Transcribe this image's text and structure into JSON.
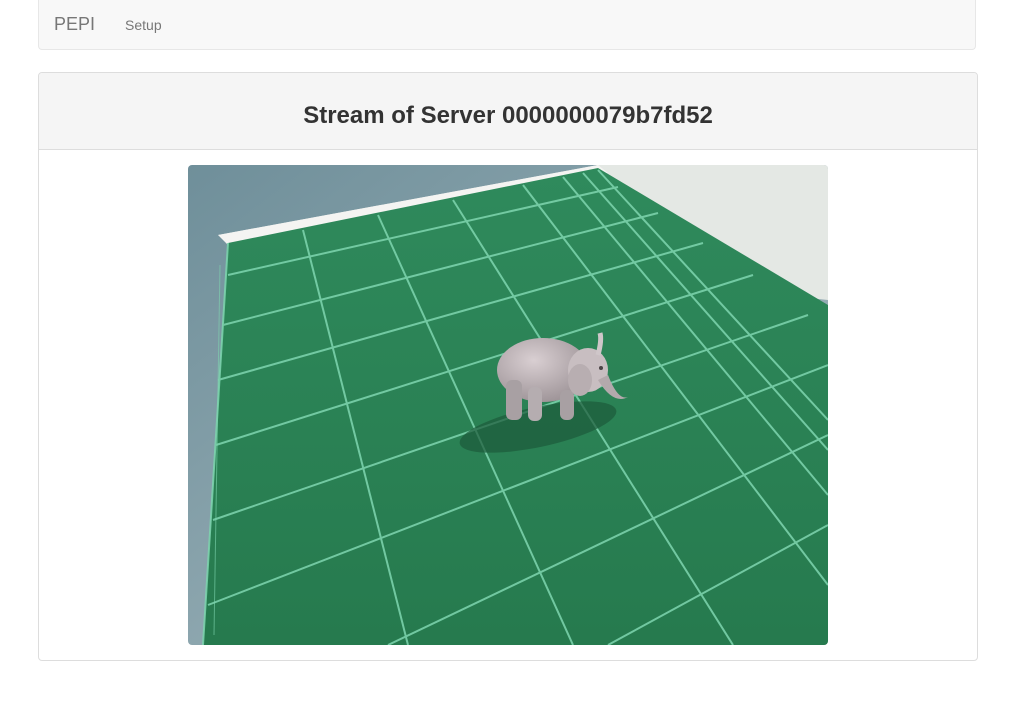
{
  "navbar": {
    "brand": "PEPI",
    "links": [
      {
        "label": "Setup"
      }
    ]
  },
  "panel": {
    "title": "Stream of Server 0000000079b7fd52"
  },
  "stream": {
    "description_icon": "camera-stream-image"
  }
}
